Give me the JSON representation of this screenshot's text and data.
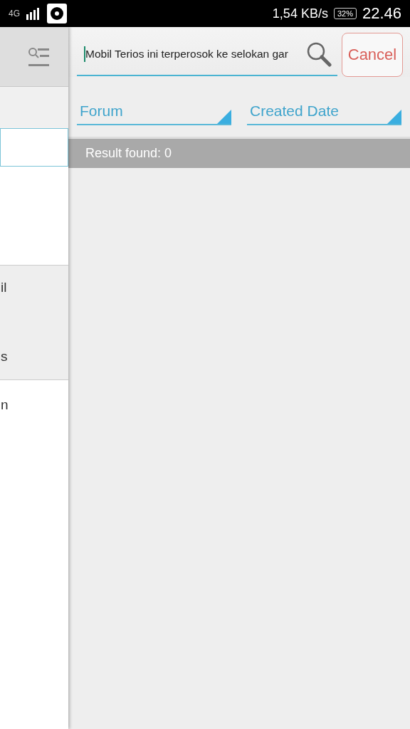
{
  "status_bar": {
    "network": "4G",
    "speed": "1,54 KB/s",
    "battery": "32%",
    "time": "22.46"
  },
  "side_panel": {
    "fragments": [
      {
        "text": "il",
        "shaded": true
      },
      {
        "text": "s",
        "shaded": true
      },
      {
        "text": "n",
        "shaded": false
      }
    ]
  },
  "search": {
    "value": "Mobil Terios ini terperosok ke selokan gar",
    "cancel": "Cancel"
  },
  "filters": [
    {
      "label": "Forum"
    },
    {
      "label": "Created Date"
    }
  ],
  "result": "Result found: 0"
}
